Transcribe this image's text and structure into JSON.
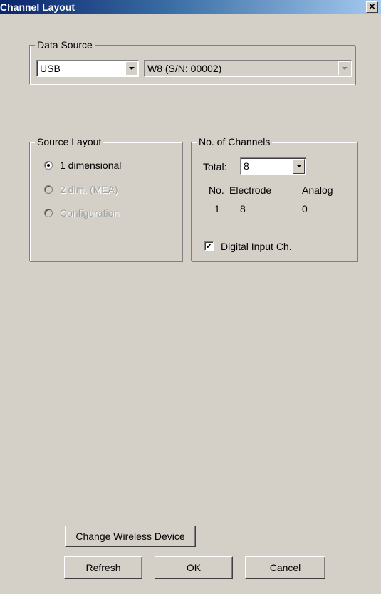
{
  "window": {
    "title": "Channel Layout",
    "close_glyph": "×"
  },
  "data_source": {
    "legend": "Data Source",
    "source_select": "USB",
    "device_select": "W8 (S/N: 00002)"
  },
  "source_layout": {
    "legend": "Source Layout",
    "options": [
      {
        "label": "1 dimensional",
        "checked": true,
        "enabled": true
      },
      {
        "label": "2 dim. (MEA)",
        "checked": false,
        "enabled": false
      },
      {
        "label": "Configuration",
        "checked": false,
        "enabled": false
      }
    ]
  },
  "channels": {
    "legend": "No. of Channels",
    "total_label": "Total:",
    "total_value": "8",
    "headers": {
      "no": "No.",
      "electrode": "Electrode",
      "analog": "Analog"
    },
    "row": {
      "no": "1",
      "electrode": "8",
      "analog": "0"
    },
    "digital_input_label": "Digital Input Ch.",
    "digital_input_checked": true,
    "check_glyph": "✔"
  },
  "buttons": {
    "change_wireless": "Change Wireless Device",
    "refresh": "Refresh",
    "ok": "OK",
    "cancel": "Cancel"
  }
}
